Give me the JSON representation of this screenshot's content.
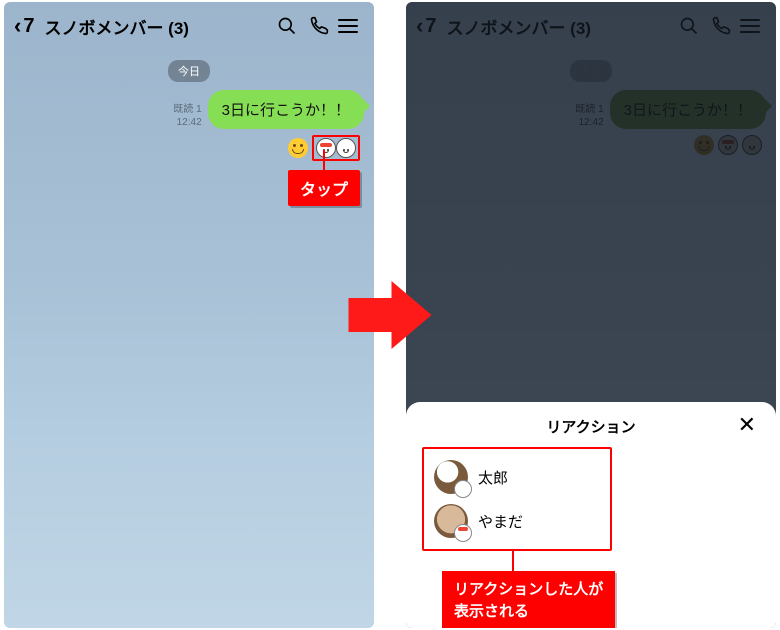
{
  "header": {
    "back_count": "7",
    "title": "スノボメンバー (3)"
  },
  "chat": {
    "date_label": "今日",
    "read_label": "既読 1",
    "time": "12:42",
    "message": "3日に行こうか！！"
  },
  "annotations": {
    "tap_label": "タップ",
    "reaction_caption_line1": "リアクションした人が",
    "reaction_caption_line2": "表示される"
  },
  "sheet": {
    "title": "リアクション",
    "people": [
      {
        "name": "太郎"
      },
      {
        "name": "やまだ"
      }
    ]
  },
  "icons": {
    "search": "search-icon",
    "call": "phone-icon",
    "menu": "menu-icon",
    "close": "close-icon"
  }
}
